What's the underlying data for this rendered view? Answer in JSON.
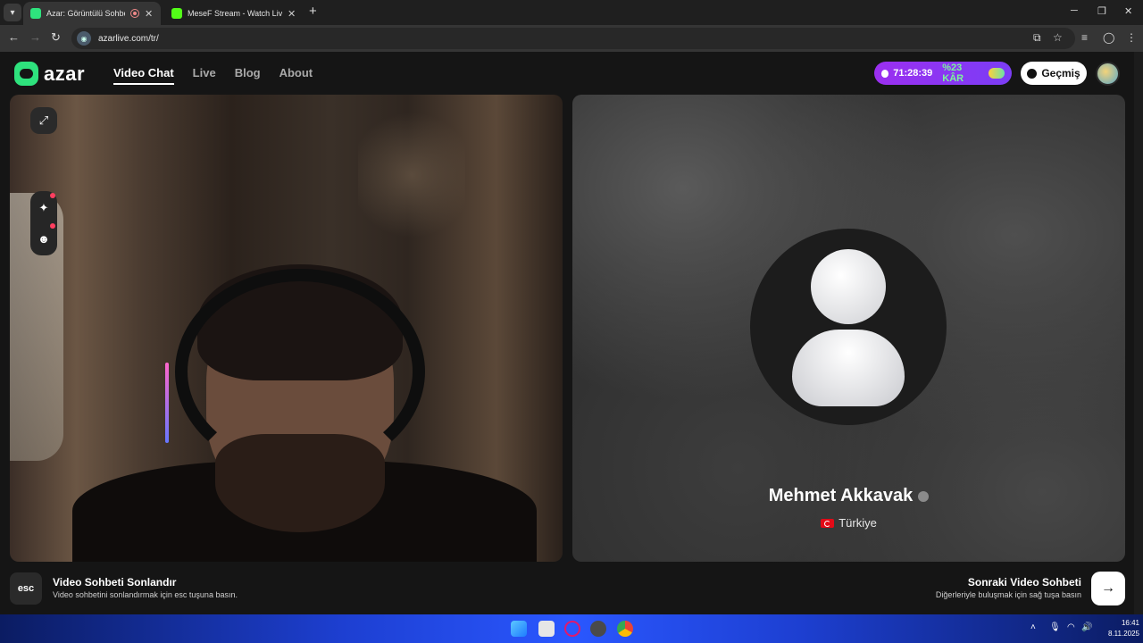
{
  "browser": {
    "tabs": [
      {
        "title": "Azar: Görüntülü Sohbet, Ye",
        "active": true
      },
      {
        "title": "MeseF Stream - Watch Live on",
        "active": false
      }
    ],
    "url": "azarlive.com/tr/"
  },
  "header": {
    "logo_text": "azar",
    "nav": [
      "Video Chat",
      "Live",
      "Blog",
      "About"
    ],
    "promo_timer": "71:28:39",
    "promo_discount": "%23 KÂR",
    "history_label": "Geçmiş"
  },
  "peer": {
    "name": "Mehmet Akkavak",
    "country": "Türkiye"
  },
  "actions": {
    "esc_key": "esc",
    "end_title": "Video Sohbeti Sonlandır",
    "end_sub": "Video sohbetini sonlandırmak için esc tuşuna basın.",
    "next_title": "Sonraki Video Sohbeti",
    "next_sub": "Diğerleriyle buluşmak için sağ tuşa basın"
  },
  "taskbar": {
    "time": "16:41",
    "date": "8.11.2025"
  },
  "colors": {
    "brand": "#2ee27d",
    "promo": "#9b2ff0",
    "promo_discount": "#7cf59b",
    "badge": "#ff3e5f"
  }
}
